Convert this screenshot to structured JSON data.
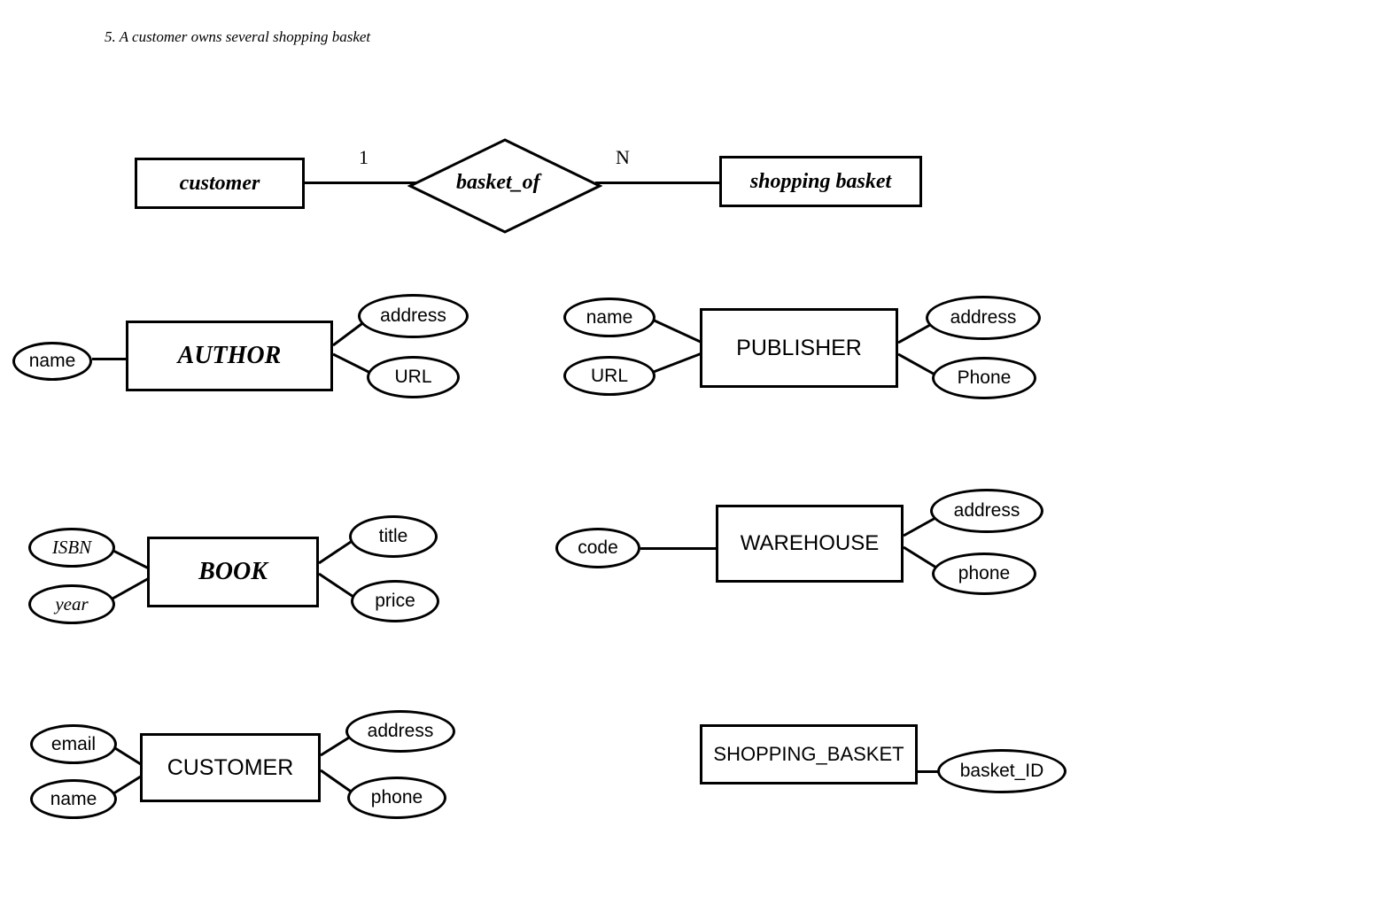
{
  "caption": "5. A customer owns several shopping basket",
  "relationship": {
    "left_entity": "customer",
    "diamond": "basket_of",
    "right_entity": "shopping basket",
    "card_left": "1",
    "card_right": "N"
  },
  "entities": {
    "author": {
      "name": "AUTHOR",
      "attrs": {
        "name": "name",
        "address": "address",
        "url": "URL"
      }
    },
    "publisher": {
      "name": "PUBLISHER",
      "attrs": {
        "name": "name",
        "url": "URL",
        "address": "address",
        "phone": "Phone"
      }
    },
    "book": {
      "name": "BOOK",
      "attrs": {
        "isbn": "ISBN",
        "year": "year",
        "title": "title",
        "price": "price"
      }
    },
    "warehouse": {
      "name": "WAREHOUSE",
      "attrs": {
        "code": "code",
        "address": "address",
        "phone": "phone"
      }
    },
    "customer": {
      "name": "CUSTOMER",
      "attrs": {
        "email": "email",
        "name": "name",
        "address": "address",
        "phone": "phone"
      }
    },
    "shopping_basket": {
      "name": "SHOPPING_BASKET",
      "attrs": {
        "basket_id": "basket_ID"
      }
    }
  }
}
